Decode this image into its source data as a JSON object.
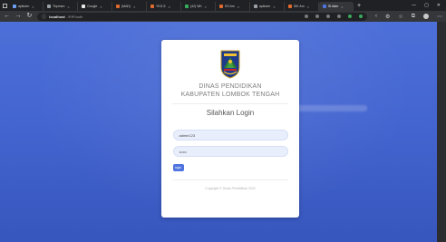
{
  "browser": {
    "tabs": [
      {
        "label": "apikotm",
        "color": "#6d9ef2",
        "active": false
      },
      {
        "label": "Tkpmsm",
        "color": "#9aa0a6",
        "active": false
      },
      {
        "label": "Google",
        "color": "#e9e9e9",
        "active": false
      },
      {
        "label": "(MAD)",
        "color": "#e06b2e",
        "active": false
      },
      {
        "label": "YKG-5",
        "color": "#e06b2e",
        "active": false
      },
      {
        "label": "(42) Wh",
        "color": "#35b05a",
        "active": false
      },
      {
        "label": "SS Am",
        "color": "#e06b2e",
        "active": false
      },
      {
        "label": "apikotm",
        "color": "#9aa0a6",
        "active": false
      },
      {
        "label": "SIK Am",
        "color": "#e06b2e",
        "active": false
      },
      {
        "label": "SI Adm",
        "color": "#4e73df",
        "active": true
      }
    ],
    "new_tab": "+",
    "url_host": "localhost",
    "url_path": "/RIP/auth"
  },
  "login": {
    "org_line1": "DINAS PENDIDIKAN",
    "org_line2": "KABUPATEN LOMBOK TENGAH",
    "title": "Silahkan Login",
    "username_value": "admin123",
    "password_value": "••••••",
    "button_label": "login",
    "copyright": "Copyright © Dinas Pendidikan 2022"
  },
  "colors": {
    "background": "#4465d0",
    "primary": "#4e73df",
    "card": "#ffffff"
  },
  "icons": {
    "logo": "lombok-tengah-emblem",
    "back": "back-arrow-icon",
    "forward": "forward-arrow-icon",
    "reload": "reload-icon"
  }
}
